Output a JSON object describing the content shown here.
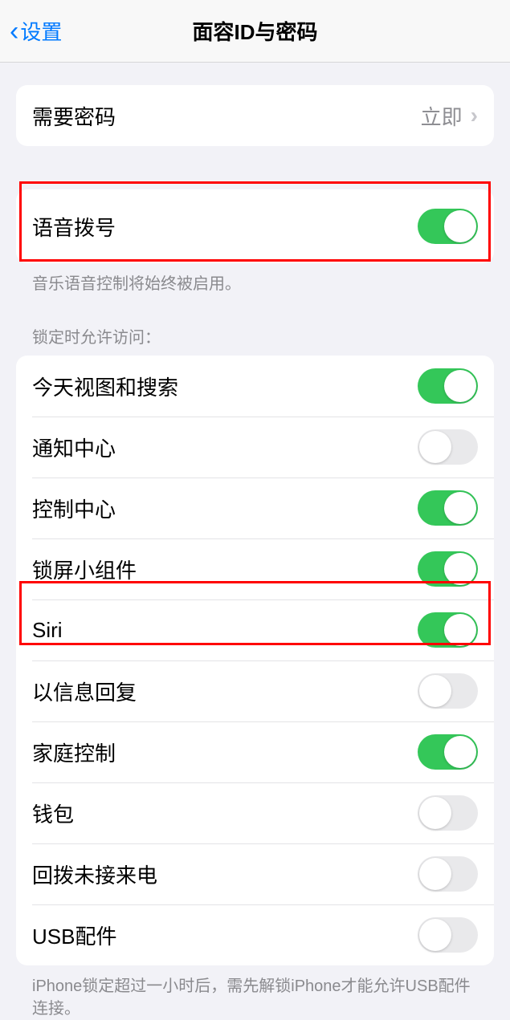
{
  "header": {
    "back_label": "设置",
    "title": "面容ID与密码"
  },
  "passcode": {
    "label": "需要密码",
    "value": "立即"
  },
  "voice_dial": {
    "label": "语音拨号",
    "on": true,
    "footer": "音乐语音控制将始终被启用。"
  },
  "locked_section": {
    "header": "锁定时允许访问：",
    "items": [
      {
        "label": "今天视图和搜索",
        "on": true
      },
      {
        "label": "通知中心",
        "on": false
      },
      {
        "label": "控制中心",
        "on": true
      },
      {
        "label": "锁屏小组件",
        "on": true
      },
      {
        "label": "Siri",
        "on": true
      },
      {
        "label": "以信息回复",
        "on": false
      },
      {
        "label": "家庭控制",
        "on": true
      },
      {
        "label": "钱包",
        "on": false
      },
      {
        "label": "回拨未接来电",
        "on": false
      },
      {
        "label": "USB配件",
        "on": false
      }
    ],
    "footer": "iPhone锁定超过一小时后，需先解锁iPhone才能允许USB配件连接。"
  }
}
